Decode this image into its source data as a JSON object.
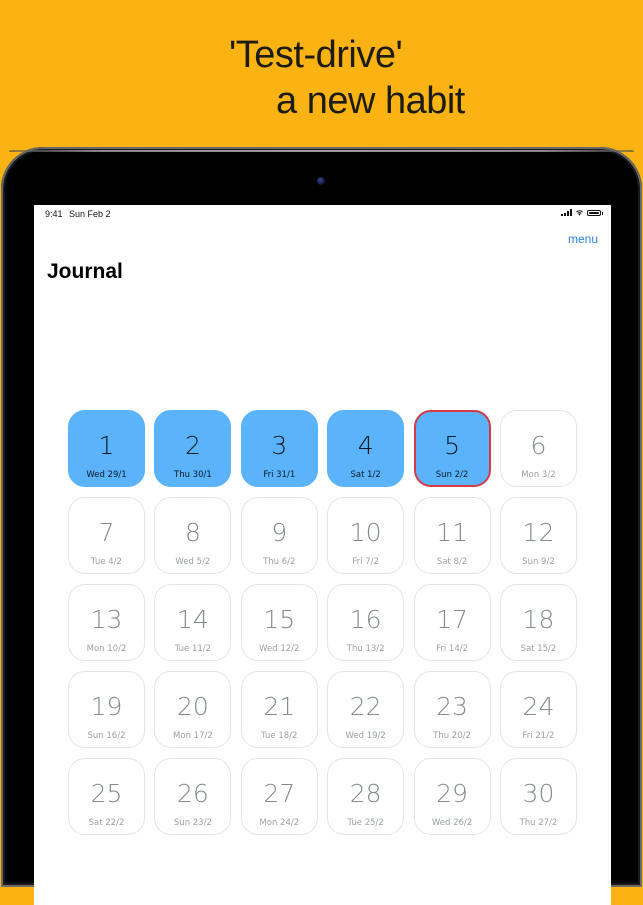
{
  "headline": {
    "line1": "'Test-drive'",
    "line2": "a new habit"
  },
  "status_bar": {
    "time": "9:41",
    "date": "Sun Feb 2"
  },
  "nav": {
    "menu_label": "menu",
    "title": "Journal"
  },
  "colors": {
    "background": "#FBB313",
    "done": "#5ab3fb",
    "today_border": "#d43a4a",
    "link": "#2f7fe0"
  },
  "days": [
    {
      "number": "1",
      "date": "Wed 29/1",
      "state": "done"
    },
    {
      "number": "2",
      "date": "Thu 30/1",
      "state": "done"
    },
    {
      "number": "3",
      "date": "Fri 31/1",
      "state": "done"
    },
    {
      "number": "4",
      "date": "Sat 1/2",
      "state": "done"
    },
    {
      "number": "5",
      "date": "Sun 2/2",
      "state": "done-today"
    },
    {
      "number": "6",
      "date": "Mon 3/2",
      "state": "future"
    },
    {
      "number": "7",
      "date": "Tue 4/2",
      "state": "future"
    },
    {
      "number": "8",
      "date": "Wed 5/2",
      "state": "future"
    },
    {
      "number": "9",
      "date": "Thu 6/2",
      "state": "future"
    },
    {
      "number": "10",
      "date": "Fri 7/2",
      "state": "future"
    },
    {
      "number": "11",
      "date": "Sat 8/2",
      "state": "future"
    },
    {
      "number": "12",
      "date": "Sun 9/2",
      "state": "future"
    },
    {
      "number": "13",
      "date": "Mon 10/2",
      "state": "future"
    },
    {
      "number": "14",
      "date": "Tue 11/2",
      "state": "future"
    },
    {
      "number": "15",
      "date": "Wed 12/2",
      "state": "future"
    },
    {
      "number": "16",
      "date": "Thu 13/2",
      "state": "future"
    },
    {
      "number": "17",
      "date": "Fri 14/2",
      "state": "future"
    },
    {
      "number": "18",
      "date": "Sat 15/2",
      "state": "future"
    },
    {
      "number": "19",
      "date": "Sun 16/2",
      "state": "future"
    },
    {
      "number": "20",
      "date": "Mon 17/2",
      "state": "future"
    },
    {
      "number": "21",
      "date": "Tue 18/2",
      "state": "future"
    },
    {
      "number": "22",
      "date": "Wed 19/2",
      "state": "future"
    },
    {
      "number": "23",
      "date": "Thu 20/2",
      "state": "future"
    },
    {
      "number": "24",
      "date": "Fri 21/2",
      "state": "future"
    },
    {
      "number": "25",
      "date": "Sat 22/2",
      "state": "future"
    },
    {
      "number": "26",
      "date": "Sun 23/2",
      "state": "future"
    },
    {
      "number": "27",
      "date": "Mon 24/2",
      "state": "future"
    },
    {
      "number": "28",
      "date": "Tue 25/2",
      "state": "future"
    },
    {
      "number": "29",
      "date": "Wed 26/2",
      "state": "future"
    },
    {
      "number": "30",
      "date": "Thu 27/2",
      "state": "future"
    }
  ]
}
